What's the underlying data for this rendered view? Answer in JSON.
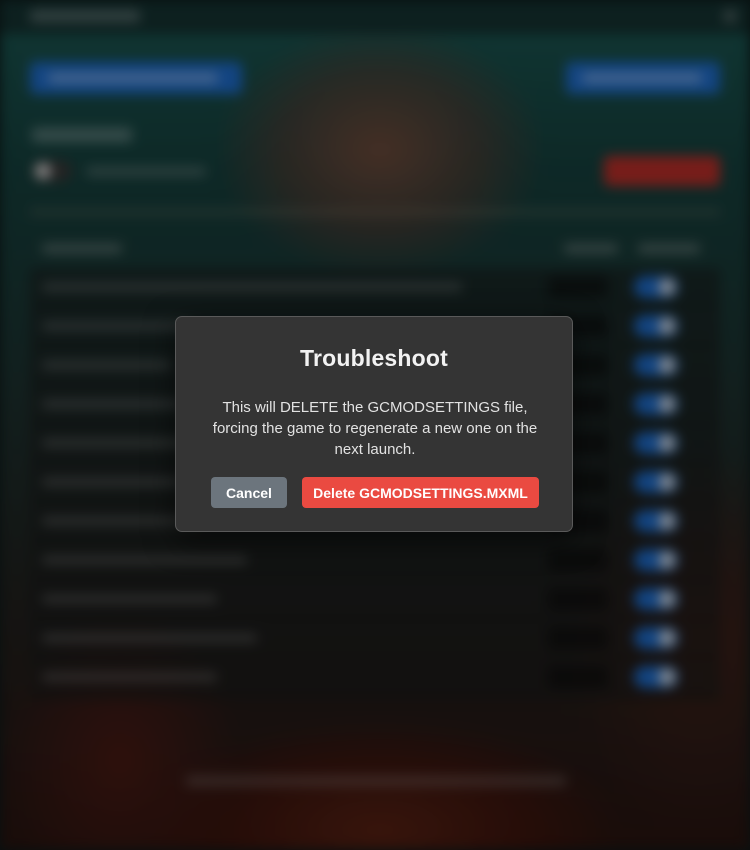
{
  "dialog": {
    "title": "Troubleshoot",
    "message": "This will DELETE the GCMODSETTINGS file, forcing the game to regenerate a new one on the next launch.",
    "cancel_label": "Cancel",
    "confirm_label": "Delete GCMODSETTINGS.MXML"
  },
  "colors": {
    "dialog_background": "#343434",
    "cancel_button": "#6c757d",
    "confirm_button": "#ea4a41",
    "background_accent_blue": "#1f6fd1"
  }
}
